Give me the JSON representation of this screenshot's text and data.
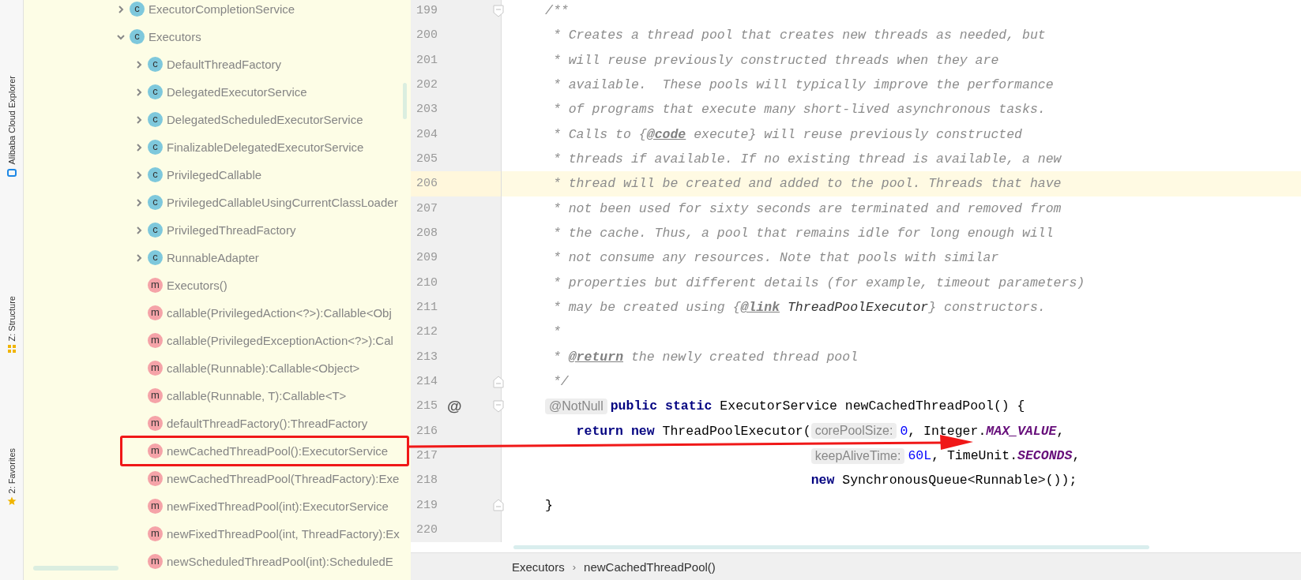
{
  "tool_strip": [
    {
      "label": "Alibaba Cloud Explorer"
    },
    {
      "label": "Z: Structure"
    },
    {
      "label": "2: Favorites"
    }
  ],
  "project_tree": [
    {
      "name": "ExecutorCompletionService",
      "kind": "class",
      "icon_text": "c",
      "expanded": false,
      "annotated": false
    },
    {
      "name": "Executors",
      "kind": "class",
      "icon_text": "c",
      "expanded": true,
      "annotated": false,
      "children": [
        {
          "name": "DefaultThreadFactory",
          "kind": "class",
          "icon_text": "c",
          "expanded": false,
          "annotated": false
        },
        {
          "name": "DelegatedExecutorService",
          "kind": "class",
          "icon_text": "c",
          "expanded": false,
          "annotated": false
        },
        {
          "name": "DelegatedScheduledExecutorService",
          "kind": "class",
          "icon_text": "c",
          "expanded": false,
          "annotated": false
        },
        {
          "name": "FinalizableDelegatedExecutorService",
          "kind": "class",
          "icon_text": "c",
          "expanded": false,
          "annotated": false
        },
        {
          "name": "PrivilegedCallable",
          "kind": "class",
          "icon_text": "c",
          "expanded": false,
          "annotated": false
        },
        {
          "name": "PrivilegedCallableUsingCurrentClassLoader",
          "kind": "class",
          "icon_text": "c",
          "expanded": false,
          "annotated": false
        },
        {
          "name": "PrivilegedThreadFactory",
          "kind": "class",
          "icon_text": "c",
          "expanded": false,
          "annotated": false
        },
        {
          "name": "RunnableAdapter",
          "kind": "class",
          "icon_text": "c",
          "expanded": false,
          "annotated": false
        },
        {
          "name": "Executors()",
          "kind": "method",
          "icon_text": "m",
          "annotated": false
        },
        {
          "name": "callable(PrivilegedAction<?>):Callable<Obj",
          "kind": "method",
          "icon_text": "m",
          "annotated": false
        },
        {
          "name": "callable(PrivilegedExceptionAction<?>):Cal",
          "kind": "method",
          "icon_text": "m",
          "annotated": false
        },
        {
          "name": "callable(Runnable):Callable<Object>",
          "kind": "method",
          "icon_text": "m",
          "annotated": false
        },
        {
          "name": "callable(Runnable, T):Callable<T>",
          "kind": "method",
          "icon_text": "m",
          "annotated": false
        },
        {
          "name": "defaultThreadFactory():ThreadFactory",
          "kind": "method",
          "icon_text": "m",
          "annotated": false
        },
        {
          "name": "newCachedThreadPool():ExecutorService",
          "kind": "method",
          "icon_text": "m",
          "annotated": true
        },
        {
          "name": "newCachedThreadPool(ThreadFactory):Exe",
          "kind": "method",
          "icon_text": "m",
          "annotated": false
        },
        {
          "name": "newFixedThreadPool(int):ExecutorService",
          "kind": "method",
          "icon_text": "m",
          "annotated": false
        },
        {
          "name": "newFixedThreadPool(int, ThreadFactory):Ex",
          "kind": "method",
          "icon_text": "m",
          "annotated": false
        },
        {
          "name": "newScheduledThreadPool(int):ScheduledE",
          "kind": "method",
          "icon_text": "m",
          "annotated": false
        }
      ]
    }
  ],
  "editor": {
    "lines": [
      {
        "number": "199",
        "kind": "fold_start",
        "current": false,
        "continuation": false,
        "segments": [
          {
            "kind": "comment",
            "text": "/**"
          }
        ]
      },
      {
        "number": "200",
        "kind": "code",
        "current": false,
        "continuation": false,
        "segments": [
          {
            "kind": "comment",
            "text": " * Creates a thread pool that creates new threads as needed, but"
          }
        ]
      },
      {
        "number": "201",
        "kind": "code",
        "current": false,
        "continuation": false,
        "segments": [
          {
            "kind": "comment",
            "text": " * will reuse previously constructed threads when they are"
          }
        ]
      },
      {
        "number": "202",
        "kind": "code",
        "current": false,
        "continuation": false,
        "segments": [
          {
            "kind": "comment",
            "text": " * available.  These pools will typically improve the performance"
          }
        ]
      },
      {
        "number": "203",
        "kind": "code",
        "current": false,
        "continuation": false,
        "segments": [
          {
            "kind": "comment",
            "text": " * of programs that execute many short-lived asynchronous tasks."
          }
        ]
      },
      {
        "number": "204",
        "kind": "code",
        "current": false,
        "continuation": false,
        "segments": [
          {
            "kind": "comment",
            "text": " * Calls to {"
          },
          {
            "kind": "tag",
            "text": "@code"
          },
          {
            "kind": "comment",
            "text": " execute} will reuse previously constructed"
          }
        ]
      },
      {
        "number": "205",
        "kind": "code",
        "current": false,
        "continuation": false,
        "segments": [
          {
            "kind": "comment",
            "text": " * threads if available. If no existing thread is available, a new"
          }
        ]
      },
      {
        "number": "206",
        "kind": "code",
        "current": true,
        "continuation": false,
        "segments": [
          {
            "kind": "comment",
            "text": " * thread will be created and added to the pool. Threads that have"
          }
        ]
      },
      {
        "number": "207",
        "kind": "code",
        "current": false,
        "continuation": false,
        "segments": [
          {
            "kind": "comment",
            "text": " * not been used for sixty seconds are terminated and removed from"
          }
        ]
      },
      {
        "number": "208",
        "kind": "code",
        "current": false,
        "continuation": false,
        "segments": [
          {
            "kind": "comment",
            "text": " * the cache. Thus, a pool that remains idle for long enough will"
          }
        ]
      },
      {
        "number": "209",
        "kind": "code",
        "current": false,
        "continuation": false,
        "segments": [
          {
            "kind": "comment",
            "text": " * not consume any resources. Note that pools with similar"
          }
        ]
      },
      {
        "number": "210",
        "kind": "code",
        "current": false,
        "continuation": false,
        "segments": [
          {
            "kind": "comment",
            "text": " * properties but different details (for example, timeout parameters)"
          }
        ]
      },
      {
        "number": "211",
        "kind": "code",
        "current": false,
        "continuation": false,
        "segments": [
          {
            "kind": "comment",
            "text": " * may be created using {"
          },
          {
            "kind": "tag",
            "text": "@link"
          },
          {
            "kind": "ref",
            "text": " ThreadPoolExecutor"
          },
          {
            "kind": "comment",
            "text": "} constructors."
          }
        ]
      },
      {
        "number": "212",
        "kind": "code",
        "current": false,
        "continuation": false,
        "segments": [
          {
            "kind": "comment",
            "text": " *"
          }
        ]
      },
      {
        "number": "213",
        "kind": "code",
        "current": false,
        "continuation": false,
        "segments": [
          {
            "kind": "comment",
            "text": " * "
          },
          {
            "kind": "tag",
            "text": "@return"
          },
          {
            "kind": "comment",
            "text": " the newly created thread pool"
          }
        ]
      },
      {
        "number": "214",
        "kind": "fold_end",
        "current": false,
        "continuation": false,
        "segments": [
          {
            "kind": "comment",
            "text": " */"
          }
        ]
      },
      {
        "number": "215",
        "kind": "fold_start",
        "current": false,
        "continuation": false,
        "gutter_mark": "@",
        "segments": [
          {
            "kind": "hint",
            "text": "@NotNull"
          },
          {
            "kind": "keyword",
            "text": "public static"
          },
          {
            "kind": "plain",
            "text": " ExecutorService newCachedThreadPool() {"
          }
        ]
      },
      {
        "number": "216",
        "kind": "code",
        "current": false,
        "continuation": false,
        "segments": [
          {
            "kind": "keyword",
            "text": "    return new"
          },
          {
            "kind": "plain",
            "text": " ThreadPoolExecutor("
          },
          {
            "kind": "hint",
            "text": "corePoolSize:"
          },
          {
            "kind": "number",
            "text": "0"
          },
          {
            "kind": "plain",
            "text": ", Integer."
          },
          {
            "kind": "constant",
            "text": "MAX_VALUE"
          },
          {
            "kind": "plain",
            "text": ","
          }
        ]
      },
      {
        "number": "217",
        "kind": "code",
        "current": false,
        "continuation": true,
        "segments": [
          {
            "kind": "hint",
            "text": "keepAliveTime:"
          },
          {
            "kind": "number",
            "text": "60L"
          },
          {
            "kind": "plain",
            "text": ", TimeUnit."
          },
          {
            "kind": "constant",
            "text": "SECONDS"
          },
          {
            "kind": "plain",
            "text": ","
          }
        ]
      },
      {
        "number": "218",
        "kind": "code",
        "current": false,
        "continuation": true,
        "segments": [
          {
            "kind": "keyword",
            "text": "new"
          },
          {
            "kind": "plain",
            "text": " SynchronousQueue<Runnable>());"
          }
        ]
      },
      {
        "number": "219",
        "kind": "fold_end",
        "current": false,
        "continuation": false,
        "segments": [
          {
            "kind": "plain",
            "text": "}"
          }
        ]
      },
      {
        "number": "220",
        "kind": "code",
        "current": false
      }
    ]
  },
  "breadcrumbs": [
    {
      "label": "Executors"
    },
    {
      "label": "newCachedThreadPool()"
    }
  ],
  "breadcrumb_separator": "›"
}
